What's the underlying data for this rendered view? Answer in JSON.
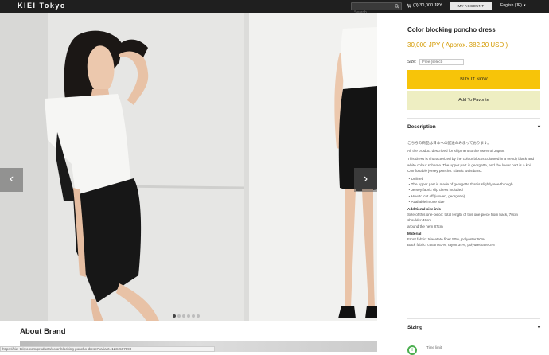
{
  "header": {
    "brand": "KIEI Tokyo",
    "search_placeholder": "Search",
    "cart_label": "(0) 30,000 JPY",
    "account_label": "MY ACCOUNT",
    "language_label": "English (JP)"
  },
  "gallery": {
    "prev_label": "‹",
    "next_label": "›",
    "dot_count": 6,
    "active_dot": 0
  },
  "about": {
    "title": "About Brand"
  },
  "statusbar": {
    "url": "https://kiei-tokyo.com/products/color-blocking-poncho-dress?variant=1234567890"
  },
  "product": {
    "title": "Color blocking poncho dress",
    "price": "30,000 JPY ( Approx. 382.20 USD )",
    "size_label": "Size:",
    "size_value": "Free (select)",
    "buy_label": "BUY IT NOW",
    "fav_label": "Add To Favorite"
  },
  "description": {
    "heading": "Description",
    "lines_jp": "こちらの商品は日本への配送のみ承っております。",
    "lines_en": "All the product described for shipment to the users of Japan.",
    "para1": "This dress is characterized by the colour blocks coloured in a trendy black and white colour scheme. The upper part is georgette, and the lower part is a knit. Comfortable jersey poncho. Elastic waistband.",
    "bullets": [
      "・Unlined",
      "・The upper part is made of georgette that is slightly see-through",
      "・Jersey fabric slip dress included",
      "・How to cut off (woven, georgette)",
      "・Available in one size"
    ],
    "size_heading": "Additional size info",
    "size_text": "Size of this one-piece: total length of this one piece from back, 70cm",
    "size_lines": [
      "shoulder 40cm",
      "around the hem 87cm"
    ],
    "material_heading": "Material",
    "material_lines": [
      "Front fabric: triacetate fiber 50%, polyester 50%",
      "Back fabric: cotton 63%, rayon 34%, polyurethane 3%"
    ]
  },
  "sizing": {
    "heading": "Sizing",
    "note": "Time limit"
  }
}
